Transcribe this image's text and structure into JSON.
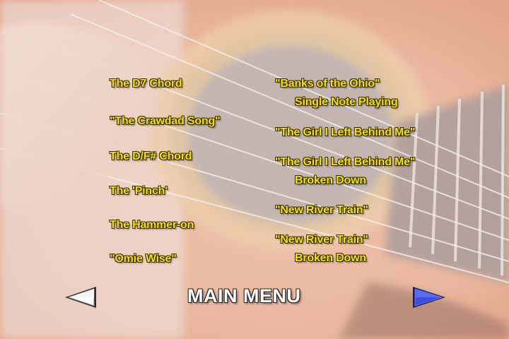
{
  "menu": {
    "left_items": [
      {
        "label": "The D7 Chord"
      },
      {
        "label": "\"The Crawdad Song\""
      },
      {
        "label": "The D/F# Chord"
      },
      {
        "label": "The 'Pinch'"
      },
      {
        "label": "The Hammer-on"
      },
      {
        "label": "\"Omie Wise\""
      }
    ],
    "right_items": [
      {
        "line1": "\"Banks of the Ohio\"",
        "line2": "Single Note Playing"
      },
      {
        "line1": "\"The Girl I Left Behind Me\"",
        "line2": ""
      },
      {
        "line1": "\"The Girl I Left Behind Me\"",
        "line2": "Broken Down"
      },
      {
        "line1": "\"New River Train\"",
        "line2": ""
      },
      {
        "line1": "\"New River Train\"",
        "line2": "Broken Down"
      }
    ]
  },
  "nav": {
    "main_menu_label": "MAIN MENU",
    "prev_icon": "left-arrow-icon",
    "next_icon": "right-arrow-icon"
  },
  "colors": {
    "item_text": "#f2e400",
    "main_menu_text": "#ffffff",
    "next_arrow": "#3c4ee0",
    "prev_arrow": "#ffffff"
  }
}
